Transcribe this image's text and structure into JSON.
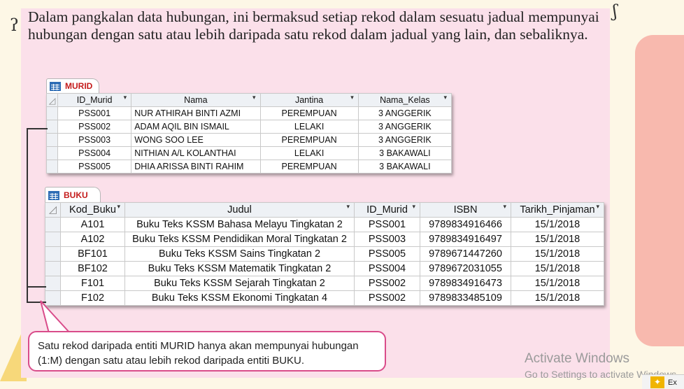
{
  "paragraph": "Dalam pangkalan data hubungan, ini bermaksud setiap rekod dalam sesuatu jadual mempunyai hubungan dengan satu atau lebih daripada satu rekod dalam jadual yang lain, dan sebaliknya.",
  "murid": {
    "tab": "MURID",
    "columns": [
      "ID_Murid",
      "Nama",
      "Jantina",
      "Nama_Kelas"
    ],
    "rows": [
      [
        "PSS001",
        "NUR ATHIRAH BINTI AZMI",
        "PEREMPUAN",
        "3 ANGGERIK"
      ],
      [
        "PSS002",
        "ADAM AQIL BIN ISMAIL",
        "LELAKI",
        "3 ANGGERIK"
      ],
      [
        "PSS003",
        "WONG SOO LEE",
        "PEREMPUAN",
        "3 ANGGERIK"
      ],
      [
        "PSS004",
        "NITHIAN A/L KOLANTHAI",
        "LELAKI",
        "3 BAKAWALI"
      ],
      [
        "PSS005",
        "DHIA ARISSA BINTI RAHIM",
        "PEREMPUAN",
        "3 BAKAWALI"
      ]
    ]
  },
  "buku": {
    "tab": "BUKU",
    "columns": [
      "Kod_Buku",
      "Judul",
      "ID_Murid",
      "ISBN",
      "Tarikh_Pinjaman"
    ],
    "rows": [
      [
        "A101",
        "Buku Teks KSSM Bahasa Melayu Tingkatan 2",
        "PSS001",
        "9789834916466",
        "15/1/2018"
      ],
      [
        "A102",
        "Buku Teks KSSM Pendidikan Moral Tingkatan 2",
        "PSS003",
        "9789834916497",
        "15/1/2018"
      ],
      [
        "BF101",
        "Buku Teks KSSM Sains Tingkatan 2",
        "PSS005",
        "9789671447260",
        "15/1/2018"
      ],
      [
        "BF102",
        "Buku Teks KSSM Matematik Tingkatan 2",
        "PSS004",
        "9789672031055",
        "15/1/2018"
      ],
      [
        "F101",
        "Buku Teks KSSM Sejarah Tingkatan 2",
        "PSS002",
        "9789834916473",
        "15/1/2018"
      ],
      [
        "F102",
        "Buku Teks KSSM Ekonomi Tingkatan 4",
        "PSS002",
        "9789833485109",
        "15/1/2018"
      ]
    ]
  },
  "callout": "Satu rekod daripada entiti MURID hanya akan mempunyai hubungan (1:M) dengan satu atau lebih rekod daripada entiti BUKU.",
  "watermark": {
    "title": "Activate Windows",
    "subtitle": "Go to Settings to activate Windows"
  },
  "taskbar": {
    "label": "Ex"
  },
  "colors": {
    "page_bg": "#fbe0ea",
    "tab_label": "#c41b1b",
    "callout_border": "#d94c8a"
  }
}
